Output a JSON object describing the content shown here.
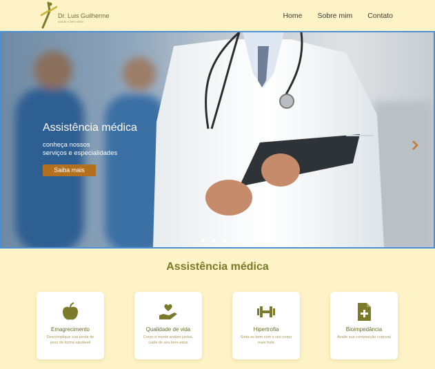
{
  "brand": {
    "name": "Dr. Luis Guilherme",
    "tagline": "saúde e bem estar"
  },
  "nav": {
    "items": [
      "Home",
      "Sobre mim",
      "Contato"
    ]
  },
  "hero": {
    "title": "Assistência médica",
    "subtitle_line1": "conheça nossos",
    "subtitle_line2": "serviços e especialidades",
    "button_label": "Saiba mais",
    "slides_count": 3,
    "active_slide": 1
  },
  "section": {
    "title": "Assistência médica"
  },
  "cards": [
    {
      "icon": "apple-icon",
      "title": "Emagrecimento",
      "description": "Descomplique sua perda de peso de forma saudável"
    },
    {
      "icon": "hand-heart-icon",
      "title": "Qualidade de vida",
      "description": "Corpo e mente andam juntos, cuide do seu bem-estar"
    },
    {
      "icon": "dumbbell-icon",
      "title": "Hipertrofia",
      "description": "Sinta-se bem com o seu corpo mais forte"
    },
    {
      "icon": "medical-file-icon",
      "title": "Bioimpedância",
      "description": "Avalie sua composição corporal"
    }
  ],
  "colors": {
    "background": "#fdf3c6",
    "accent_olive": "#7a7a2a",
    "button_orange": "#b3701f",
    "hero_border": "#4a90d9"
  }
}
